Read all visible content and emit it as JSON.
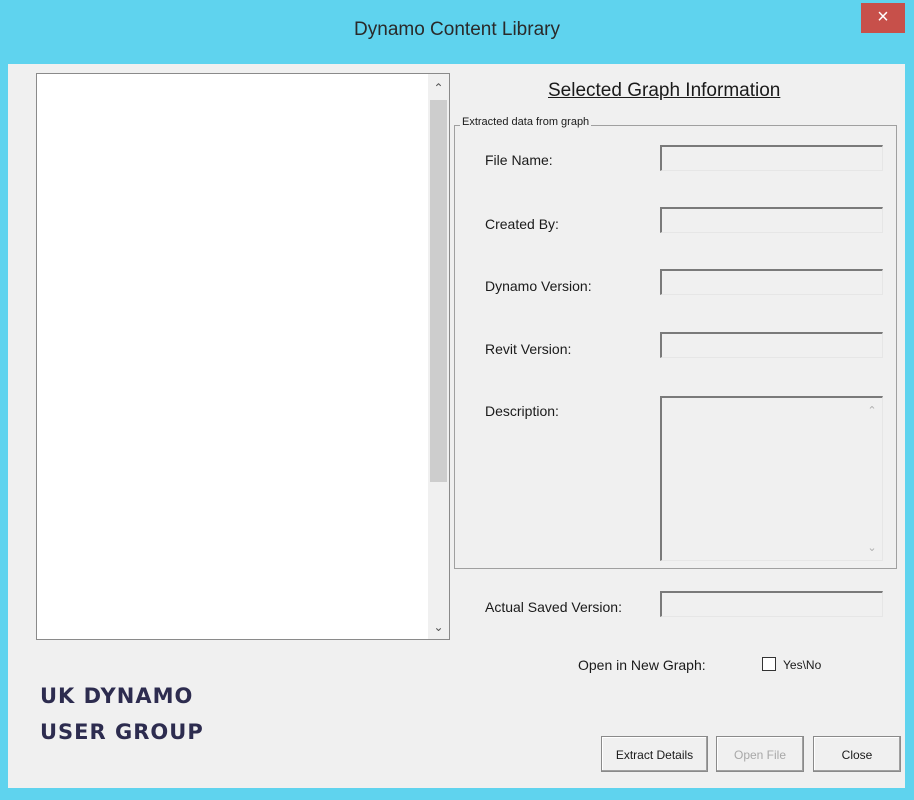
{
  "window": {
    "title": "Dynamo Content Library",
    "close_glyph": "×"
  },
  "listbox": {
    "items": [],
    "scroll_up_glyph": "⌃",
    "scroll_down_glyph": "⌄"
  },
  "info": {
    "heading": "Selected Graph Information",
    "group_label": "Extracted data from graph",
    "file_name_label": "File Name:",
    "file_name_value": "",
    "created_by_label": "Created By:",
    "created_by_value": "",
    "dynamo_version_label": "Dynamo Version:",
    "dynamo_version_value": "",
    "revit_version_label": "Revit Version:",
    "revit_version_value": "",
    "description_label": "Description:",
    "description_value": "",
    "description_up_glyph": "⌃",
    "description_down_glyph": "⌄"
  },
  "actual_saved_version_label": "Actual Saved Version:",
  "actual_saved_version_value": "",
  "open_new_graph": {
    "label": "Open in New Graph:",
    "checkbox_label": "Yes\\No",
    "checked": false
  },
  "logo": {
    "line1": "UK DYNAMO",
    "line2": "USER GROUP"
  },
  "buttons": {
    "extract_details": "Extract Details",
    "open_file": "Open File",
    "close": "Close"
  },
  "colors": {
    "title_bar": "#5fd3ee",
    "close_button": "#c7504a",
    "client_background": "#f0f0f0"
  }
}
